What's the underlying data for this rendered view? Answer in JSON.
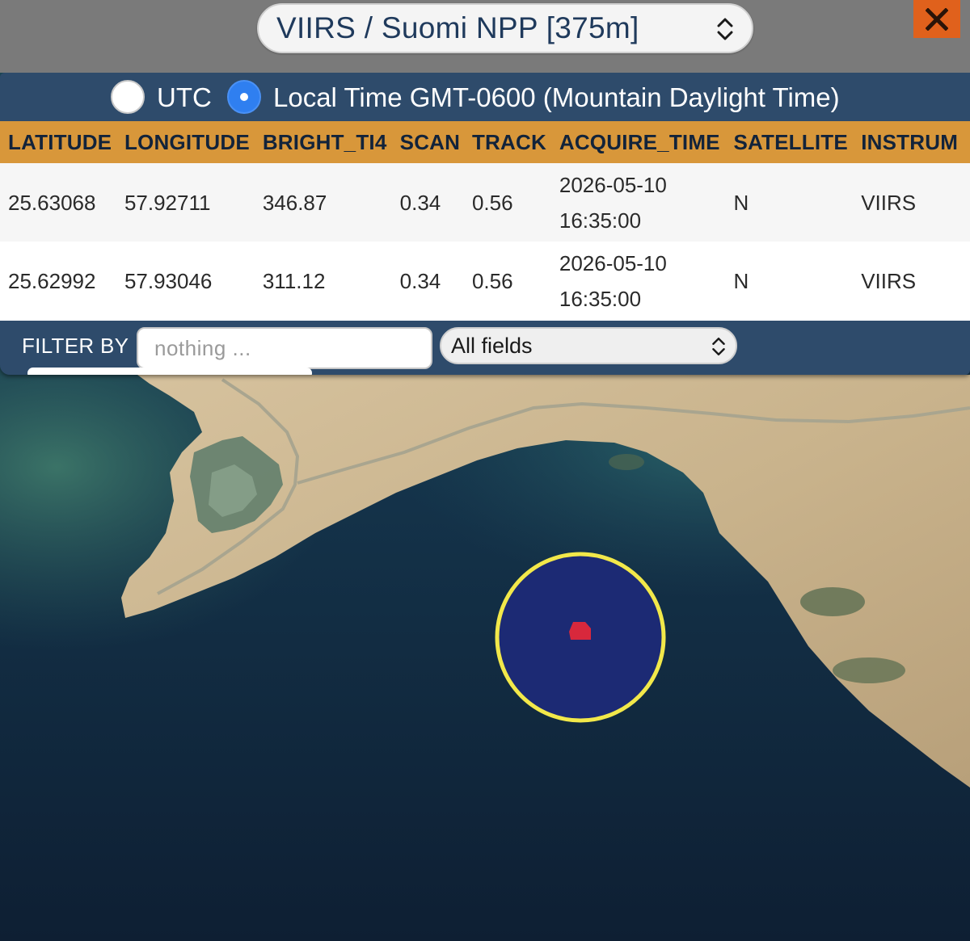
{
  "satellite_source": {
    "selected": "VIIRS / Suomi NPP [375m]"
  },
  "close_button": {
    "glyph": "✕"
  },
  "time_mode": {
    "options": [
      {
        "label": "UTC",
        "selected": false
      },
      {
        "label": "Local Time GMT-0600 (Mountain Daylight Time)",
        "selected": true
      }
    ]
  },
  "table": {
    "columns": [
      "LATITUDE",
      "LONGITUDE",
      "BRIGHT_TI4",
      "SCAN",
      "TRACK",
      "ACQUIRE_TIME",
      "SATELLITE",
      "INSTRUM"
    ],
    "rows": [
      {
        "latitude": "25.63068",
        "longitude": "57.92711",
        "bright_ti4": "346.87",
        "scan": "0.34",
        "track": "0.56",
        "acquire_date": "2026-05-10",
        "acquire_clock": "16:35:00",
        "satellite": "N",
        "instrument": "VIIRS"
      },
      {
        "latitude": "25.62992",
        "longitude": "57.93046",
        "bright_ti4": "311.12",
        "scan": "0.34",
        "track": "0.56",
        "acquire_date": "2026-05-10",
        "acquire_clock": "16:35:00",
        "satellite": "N",
        "instrument": "VIIRS"
      }
    ]
  },
  "filter": {
    "label": "FILTER BY",
    "input_placeholder": "nothing ...",
    "input_value": "",
    "field_selected": "All fields"
  },
  "map": {
    "highlight_ring_color": "#f2e84a",
    "highlight_fill_color": "#1c2a74",
    "fire_pixel_color": "#d8283c",
    "sea_color": "#142c44",
    "land_color": "#cbb48f"
  }
}
